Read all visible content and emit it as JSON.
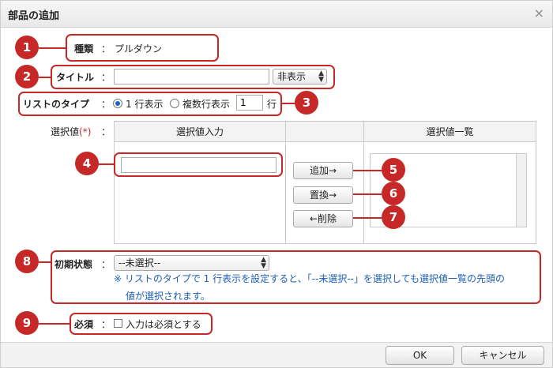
{
  "dialog": {
    "title": "部品の追加",
    "close_glyph": "×"
  },
  "kind": {
    "label": "種類",
    "colon": "：",
    "value": "プルダウン"
  },
  "title_field": {
    "label": "タイトル",
    "colon": "：",
    "value": "",
    "display_select": "非表示"
  },
  "list_type": {
    "label": "リストのタイプ",
    "colon": "：",
    "option_single": "1 行表示",
    "option_multi": "複数行表示",
    "rows_value": "1",
    "rows_unit": "行",
    "selected": "single"
  },
  "choices": {
    "label": "選択値",
    "required_mark": "(*)",
    "colon": "：",
    "col_input_header": "選択値入力",
    "col_list_header": "選択値一覧",
    "input_value": "",
    "add_button": "追加→",
    "replace_button": "置換→",
    "delete_button": "←削除"
  },
  "initial_state": {
    "label": "初期状態",
    "colon": "：",
    "selected": "--未選択--",
    "note_line1": "※ リストのタイプで 1 行表示を設定すると、「--未選択--」を選択しても選択値一覧の先頭の",
    "note_line2": "値が選択されます。"
  },
  "required": {
    "label": "必須",
    "colon": "：",
    "checkbox_label": "入力は必須とする",
    "checked": false
  },
  "footer": {
    "ok": "OK",
    "cancel": "キャンセル"
  },
  "callouts": [
    "1",
    "2",
    "3",
    "4",
    "5",
    "6",
    "7",
    "8",
    "9"
  ],
  "colors": {
    "callout": "#c62828",
    "note": "#1e5fb4",
    "radio": "#1565c0"
  }
}
